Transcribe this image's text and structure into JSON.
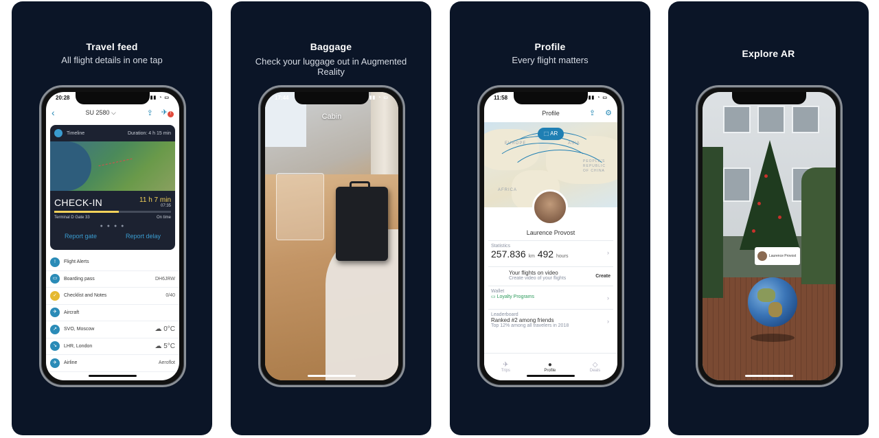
{
  "panels": [
    {
      "title": "Travel feed",
      "subtitle": "All flight details in one tap"
    },
    {
      "title": "Baggage",
      "subtitle": "Check your luggage out in Augmented Reality"
    },
    {
      "title": "Profile",
      "subtitle": "Every flight matters"
    },
    {
      "title": "Explore AR",
      "subtitle": ""
    }
  ],
  "feed": {
    "time": "20:28",
    "flight_no": "SU 2580 ⌵",
    "timeline_label": "Timeline",
    "duration": "Duration: 4 h 15 min",
    "checkin_label": "CHECK-IN",
    "checkin_countdown": "11 h 7 min",
    "checkin_time": "07:35",
    "terminal": "Terminal D Gate 33",
    "status": "On time",
    "progress": 0.55,
    "report_gate": "Report gate",
    "report_delay": "Report delay",
    "items": [
      {
        "label": "Flight Alerts",
        "value": "",
        "icon": "bell-icon",
        "temp": false
      },
      {
        "label": "Boarding pass",
        "value": "DH6JRW",
        "icon": "ticket-icon",
        "temp": false
      },
      {
        "label": "Checklist and Notes",
        "value": "0/40",
        "icon": "checklist-icon",
        "temp": false
      },
      {
        "label": "Aircraft",
        "value": "",
        "icon": "plane-icon",
        "temp": false
      },
      {
        "label": "SVO, Moscow",
        "value": "☁ 0°C",
        "icon": "departure-icon",
        "temp": true
      },
      {
        "label": "LHR, London",
        "value": "☁ 5°C",
        "icon": "arrival-icon",
        "temp": true
      },
      {
        "label": "Airline",
        "value": "Aeroflot",
        "icon": "airline-icon",
        "temp": false
      }
    ]
  },
  "baggage": {
    "time": "17:44",
    "label": "Cabin"
  },
  "profile": {
    "time": "11:58",
    "title": "Profile",
    "ar_label": "AR",
    "map_labels": [
      "EUROPE",
      "ASIA",
      "AFRICA",
      "PEOPLE'S REPUBLIC OF CHINA"
    ],
    "name": "Laurence Provost",
    "statistics_label": "Statistics",
    "distance": "257.836",
    "distance_unit": "km",
    "hours": "492",
    "hours_unit": "hours",
    "video_title": "Your flights on video",
    "video_sub": "Create video of your flights",
    "create": "Create",
    "wallet_label": "Wallet",
    "wallet_value": "Loyalty Programs",
    "leaderboard_label": "Leaderboard",
    "rank": "Ranked #2 among friends",
    "rank_sub": "Top 12% among all travelers in 2018",
    "tabs": [
      "Trips",
      "Profile",
      "Deals"
    ]
  },
  "explore": {
    "card_name": "Laurence Provost"
  }
}
